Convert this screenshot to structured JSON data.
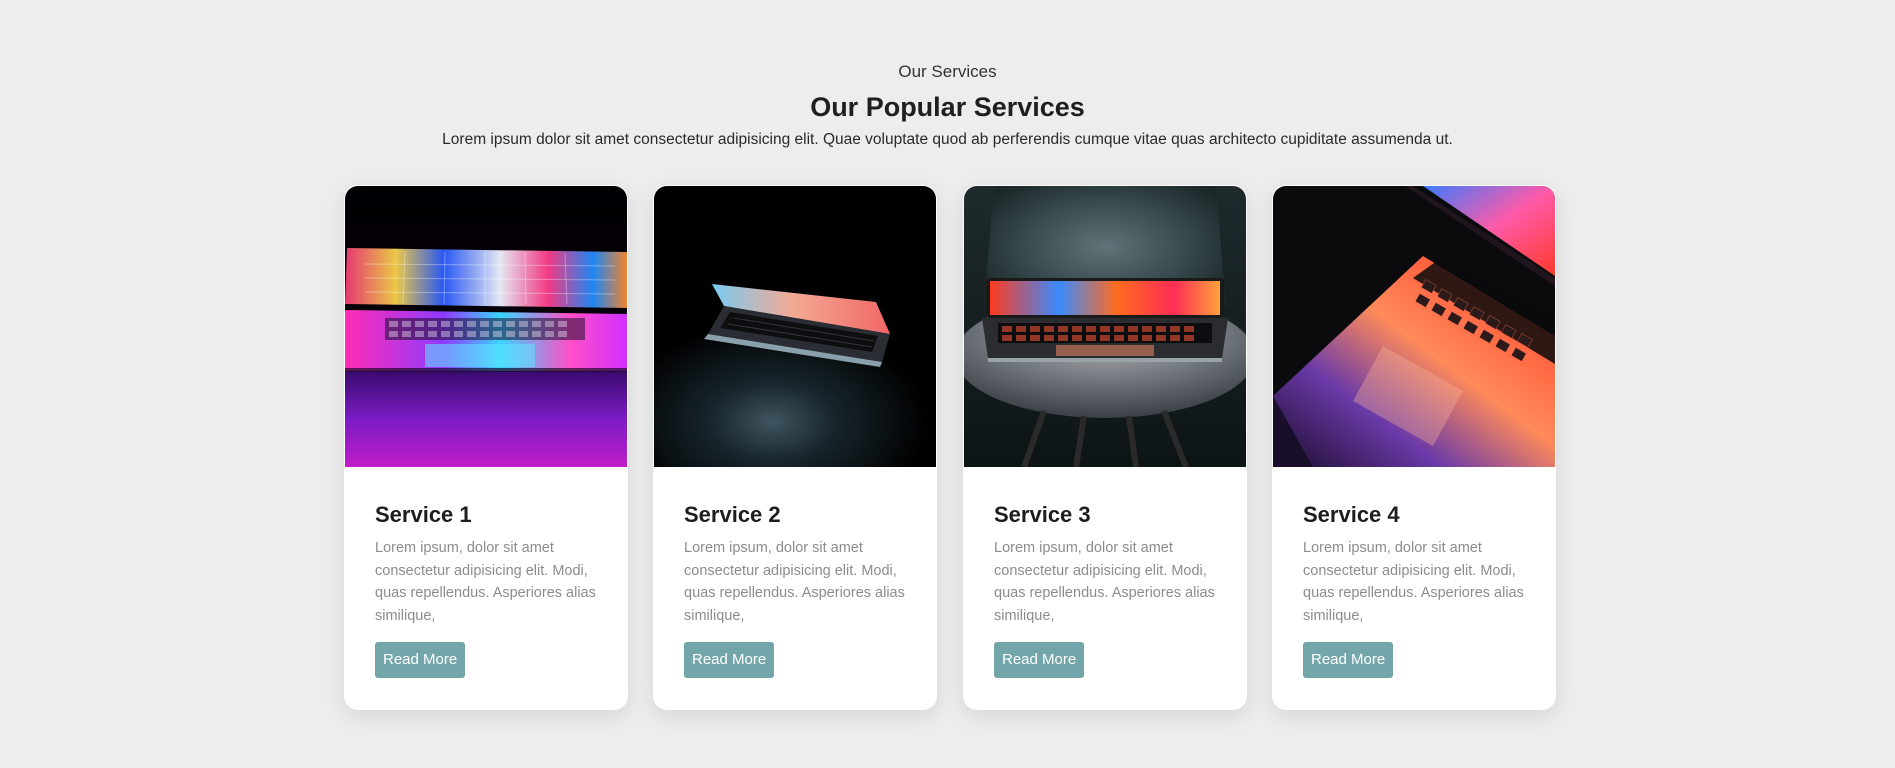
{
  "section": {
    "kicker": "Our Services",
    "title": "Our Popular Services",
    "intro": "Lorem ipsum dolor sit amet consectetur adipisicing elit. Quae voluptate quod ab perferendis cumque vitae quas architecto cupiditate assumenda ut."
  },
  "cards": [
    {
      "title": "Service 1",
      "text": "Lorem ipsum, dolor sit amet consectetur adipisicing elit. Modi, quas repellendus. Asperiores alias similique,",
      "button": "Read More",
      "image": "laptop-colorful-screen-photo"
    },
    {
      "title": "Service 2",
      "text": "Lorem ipsum, dolor sit amet consectetur adipisicing elit. Modi, quas repellendus. Asperiores alias similique,",
      "button": "Read More",
      "image": "laptop-half-open-dark-photo"
    },
    {
      "title": "Service 3",
      "text": "Lorem ipsum, dolor sit amet consectetur adipisicing elit. Modi, quas repellendus. Asperiores alias similique,",
      "button": "Read More",
      "image": "laptop-on-chair-photo"
    },
    {
      "title": "Service 4",
      "text": "Lorem ipsum, dolor sit amet consectetur adipisicing elit. Modi, quas repellendus. Asperiores alias similique,",
      "button": "Read More",
      "image": "laptop-keyboard-closeup-photo"
    }
  ],
  "colors": {
    "background": "#ededed",
    "card": "#ffffff",
    "button": "#73a6aa",
    "body_text": "#8c8c8c"
  }
}
